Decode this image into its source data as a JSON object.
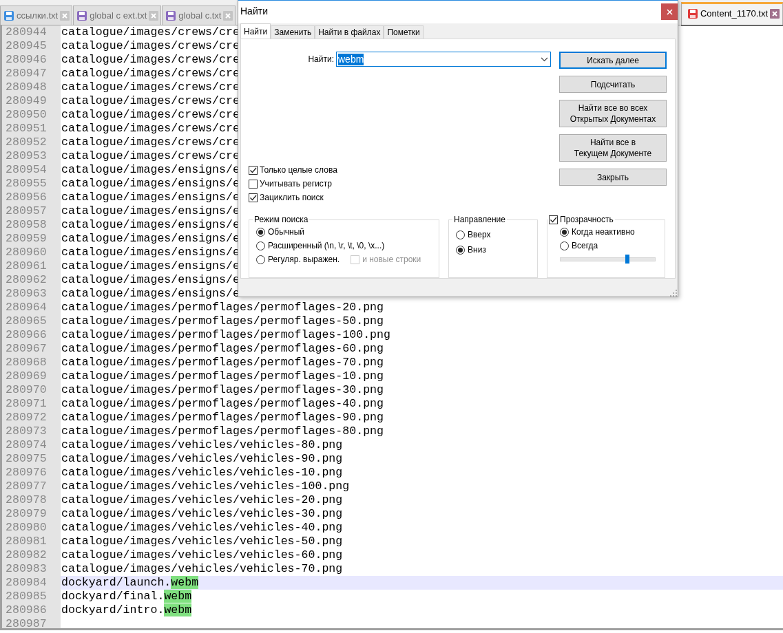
{
  "editor_tabs": [
    {
      "label": "ссылки.txt",
      "selected": false,
      "color": "#3d8ee0"
    },
    {
      "label": "global c ext.txt",
      "selected": false,
      "color": "#8a6bbf"
    },
    {
      "label": "global c.txt",
      "selected": false,
      "color": "#8a6bbf"
    },
    {
      "label": "Content_1170.txt",
      "selected": true,
      "color": "#e03a3a"
    }
  ],
  "editor": {
    "lines": [
      {
        "number": "280944",
        "text": "catalogue/images/crews/cre",
        "current": false
      },
      {
        "number": "280945",
        "text": "catalogue/images/crews/cre",
        "current": false
      },
      {
        "number": "280946",
        "text": "catalogue/images/crews/cre",
        "current": false
      },
      {
        "number": "280947",
        "text": "catalogue/images/crews/cre",
        "current": false
      },
      {
        "number": "280948",
        "text": "catalogue/images/crews/cre",
        "current": false
      },
      {
        "number": "280949",
        "text": "catalogue/images/crews/cre",
        "current": false
      },
      {
        "number": "280950",
        "text": "catalogue/images/crews/cre",
        "current": false
      },
      {
        "number": "280951",
        "text": "catalogue/images/crews/cre",
        "current": false
      },
      {
        "number": "280952",
        "text": "catalogue/images/crews/cre",
        "current": false
      },
      {
        "number": "280953",
        "text": "catalogue/images/crews/cre",
        "current": false
      },
      {
        "number": "280954",
        "text": "catalogue/images/ensigns/e",
        "current": false
      },
      {
        "number": "280955",
        "text": "catalogue/images/ensigns/e",
        "current": false
      },
      {
        "number": "280956",
        "text": "catalogue/images/ensigns/e",
        "current": false
      },
      {
        "number": "280957",
        "text": "catalogue/images/ensigns/e",
        "current": false
      },
      {
        "number": "280958",
        "text": "catalogue/images/ensigns/e",
        "current": false
      },
      {
        "number": "280959",
        "text": "catalogue/images/ensigns/e",
        "current": false
      },
      {
        "number": "280960",
        "text": "catalogue/images/ensigns/e",
        "current": false
      },
      {
        "number": "280961",
        "text": "catalogue/images/ensigns/e",
        "current": false
      },
      {
        "number": "280962",
        "text": "catalogue/images/ensigns/e",
        "current": false
      },
      {
        "number": "280963",
        "text": "catalogue/images/ensigns/e",
        "current": false
      },
      {
        "number": "280964",
        "text": "catalogue/images/permoflages/permoflages-20.png",
        "current": false
      },
      {
        "number": "280965",
        "text": "catalogue/images/permoflages/permoflages-50.png",
        "current": false
      },
      {
        "number": "280966",
        "text": "catalogue/images/permoflages/permoflages-100.png",
        "current": false
      },
      {
        "number": "280967",
        "text": "catalogue/images/permoflages/permoflages-60.png",
        "current": false
      },
      {
        "number": "280968",
        "text": "catalogue/images/permoflages/permoflages-70.png",
        "current": false
      },
      {
        "number": "280969",
        "text": "catalogue/images/permoflages/permoflages-10.png",
        "current": false
      },
      {
        "number": "280970",
        "text": "catalogue/images/permoflages/permoflages-30.png",
        "current": false
      },
      {
        "number": "280971",
        "text": "catalogue/images/permoflages/permoflages-40.png",
        "current": false
      },
      {
        "number": "280972",
        "text": "catalogue/images/permoflages/permoflages-90.png",
        "current": false
      },
      {
        "number": "280973",
        "text": "catalogue/images/permoflages/permoflages-80.png",
        "current": false
      },
      {
        "number": "280974",
        "text": "catalogue/images/vehicles/vehicles-80.png",
        "current": false
      },
      {
        "number": "280975",
        "text": "catalogue/images/vehicles/vehicles-90.png",
        "current": false
      },
      {
        "number": "280976",
        "text": "catalogue/images/vehicles/vehicles-10.png",
        "current": false
      },
      {
        "number": "280977",
        "text": "catalogue/images/vehicles/vehicles-100.png",
        "current": false
      },
      {
        "number": "280978",
        "text": "catalogue/images/vehicles/vehicles-20.png",
        "current": false
      },
      {
        "number": "280979",
        "text": "catalogue/images/vehicles/vehicles-30.png",
        "current": false
      },
      {
        "number": "280980",
        "text": "catalogue/images/vehicles/vehicles-40.png",
        "current": false
      },
      {
        "number": "280981",
        "text": "catalogue/images/vehicles/vehicles-50.png",
        "current": false
      },
      {
        "number": "280982",
        "text": "catalogue/images/vehicles/vehicles-60.png",
        "current": false
      },
      {
        "number": "280983",
        "text": "catalogue/images/vehicles/vehicles-70.png",
        "current": false
      },
      {
        "number": "280984",
        "text": "dockyard/launch.",
        "match": "webm",
        "current": true
      },
      {
        "number": "280985",
        "text": "dockyard/final.",
        "match": "webm",
        "current": false
      },
      {
        "number": "280986",
        "text": "dockyard/intro.",
        "match": "webm",
        "current": false
      },
      {
        "number": "280987",
        "current": false
      }
    ]
  },
  "find_dialog": {
    "title": "Найти",
    "tabs": [
      {
        "label": "Найти",
        "selected": true
      },
      {
        "label": "Заменить",
        "selected": false
      },
      {
        "label": "Найти в файлах",
        "selected": false
      },
      {
        "label": "Пометки",
        "selected": false
      }
    ],
    "find_label": "Найти:",
    "find_value": "webm",
    "buttons": [
      {
        "label": "Искать далее",
        "default": true
      },
      {
        "label": "Подсчитать",
        "default": false
      },
      {
        "label": "Найти все во всех\nОткрытых Документах",
        "default": false
      },
      {
        "label": "Найти все в\nТекущем Документе",
        "default": false
      },
      {
        "label": "Закрыть",
        "default": false
      }
    ],
    "options": [
      {
        "label": "Только целые слова",
        "checked": true
      },
      {
        "label": "Учитывать регистр",
        "checked": false
      },
      {
        "label": "Зациклить поиск",
        "checked": true
      }
    ],
    "search_mode": {
      "title": "Режим поиска",
      "options": [
        {
          "label": "Обычный",
          "selected": true
        },
        {
          "label": "Расширенный (\\n, \\r, \\t, \\0, \\x...)",
          "selected": false
        },
        {
          "label": "Регуляр. выражен.",
          "selected": false
        }
      ],
      "newline_option": {
        "label": "и новые строки",
        "checked": false,
        "disabled": true
      }
    },
    "direction": {
      "title": "Направление",
      "options": [
        {
          "label": "Вверх",
          "selected": false
        },
        {
          "label": "Вниз",
          "selected": true
        }
      ]
    },
    "transparency": {
      "title": "Прозрачность",
      "checked": true,
      "options": [
        {
          "label": "Когда неактивно",
          "selected": true
        },
        {
          "label": "Всегда",
          "selected": false
        }
      ],
      "level": 0.71
    }
  }
}
